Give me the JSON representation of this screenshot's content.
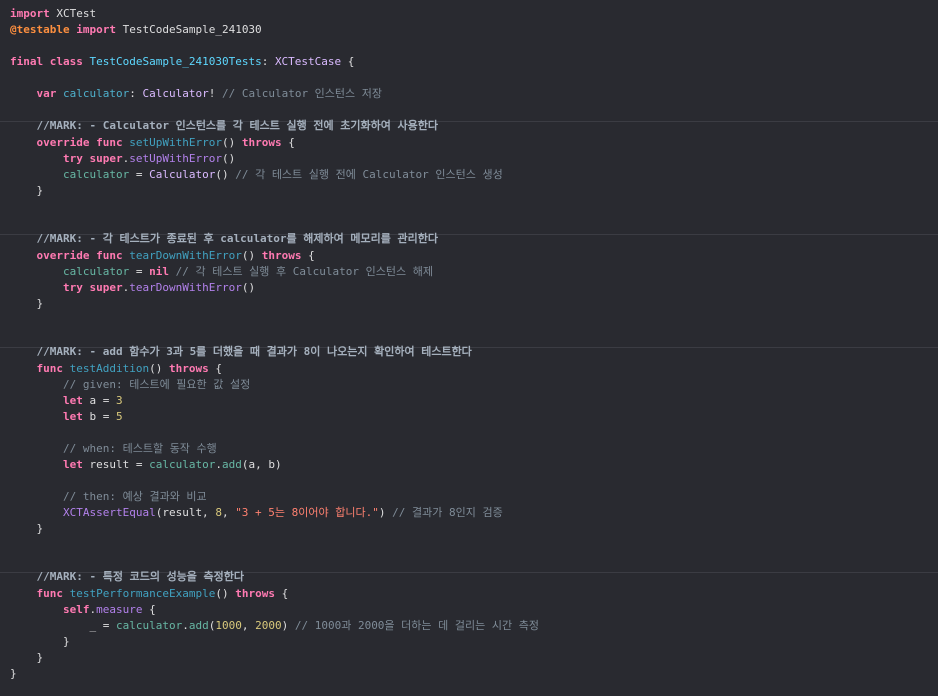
{
  "editor": {
    "lines": [
      {
        "spans": [
          {
            "c": "kw",
            "t": "import"
          },
          {
            "c": "plain",
            "t": " XCTest"
          }
        ]
      },
      {
        "spans": [
          {
            "c": "attr",
            "t": "@testable"
          },
          {
            "c": "plain",
            "t": " "
          },
          {
            "c": "kw",
            "t": "import"
          },
          {
            "c": "plain",
            "t": " TestCodeSample_241030"
          }
        ]
      },
      {
        "spans": []
      },
      {
        "spans": [
          {
            "c": "kw",
            "t": "final"
          },
          {
            "c": "plain",
            "t": " "
          },
          {
            "c": "kw",
            "t": "class"
          },
          {
            "c": "plain",
            "t": " "
          },
          {
            "c": "ctype",
            "t": "TestCodeSample_241030Tests"
          },
          {
            "c": "plain",
            "t": ": "
          },
          {
            "c": "type",
            "t": "XCTestCase"
          },
          {
            "c": "plain",
            "t": " {"
          }
        ]
      },
      {
        "spans": []
      },
      {
        "spans": [
          {
            "c": "ws",
            "t": "    "
          },
          {
            "c": "kw",
            "t": "var"
          },
          {
            "c": "plain",
            "t": " "
          },
          {
            "c": "prop",
            "t": "calculator"
          },
          {
            "c": "plain",
            "t": ": "
          },
          {
            "c": "type",
            "t": "Calculator"
          },
          {
            "c": "plain",
            "t": "! "
          },
          {
            "c": "cmt",
            "t": "// Calculator 인스턴스 저장"
          }
        ]
      },
      {
        "spans": []
      },
      {
        "spans": [
          {
            "c": "ws",
            "t": "    "
          },
          {
            "c": "mark",
            "t": "//MARK: - Calculator 인스턴스를 각 테스트 실행 전에 초기화하여 사용한다"
          }
        ]
      },
      {
        "spans": [
          {
            "c": "ws",
            "t": "    "
          },
          {
            "c": "kw",
            "t": "override"
          },
          {
            "c": "plain",
            "t": " "
          },
          {
            "c": "kw",
            "t": "func"
          },
          {
            "c": "plain",
            "t": " "
          },
          {
            "c": "fnd",
            "t": "setUpWithError"
          },
          {
            "c": "plain",
            "t": "() "
          },
          {
            "c": "kw",
            "t": "throws"
          },
          {
            "c": "plain",
            "t": " {"
          }
        ]
      },
      {
        "spans": [
          {
            "c": "ws",
            "t": "        "
          },
          {
            "c": "kw",
            "t": "try"
          },
          {
            "c": "plain",
            "t": " "
          },
          {
            "c": "kw",
            "t": "super"
          },
          {
            "c": "plain",
            "t": "."
          },
          {
            "c": "call",
            "t": "setUpWithError"
          },
          {
            "c": "plain",
            "t": "()"
          }
        ]
      },
      {
        "spans": [
          {
            "c": "ws",
            "t": "        "
          },
          {
            "c": "ucall",
            "t": "calculator"
          },
          {
            "c": "plain",
            "t": " = "
          },
          {
            "c": "type",
            "t": "Calculator"
          },
          {
            "c": "plain",
            "t": "() "
          },
          {
            "c": "cmt",
            "t": "// 각 테스트 실행 전에 Calculator 인스턴스 생성"
          }
        ]
      },
      {
        "spans": [
          {
            "c": "ws",
            "t": "    "
          },
          {
            "c": "plain",
            "t": "}"
          }
        ]
      },
      {
        "spans": []
      },
      {
        "spans": []
      },
      {
        "spans": [
          {
            "c": "ws",
            "t": "    "
          },
          {
            "c": "mark",
            "t": "//MARK: - 각 테스트가 종료된 후 calculator를 해제하여 메모리를 관리한다"
          }
        ]
      },
      {
        "spans": [
          {
            "c": "ws",
            "t": "    "
          },
          {
            "c": "kw",
            "t": "override"
          },
          {
            "c": "plain",
            "t": " "
          },
          {
            "c": "kw",
            "t": "func"
          },
          {
            "c": "plain",
            "t": " "
          },
          {
            "c": "fnd",
            "t": "tearDownWithError"
          },
          {
            "c": "plain",
            "t": "() "
          },
          {
            "c": "kw",
            "t": "throws"
          },
          {
            "c": "plain",
            "t": " {"
          }
        ]
      },
      {
        "spans": [
          {
            "c": "ws",
            "t": "        "
          },
          {
            "c": "ucall",
            "t": "calculator"
          },
          {
            "c": "plain",
            "t": " = "
          },
          {
            "c": "kw",
            "t": "nil"
          },
          {
            "c": "plain",
            "t": " "
          },
          {
            "c": "cmt",
            "t": "// 각 테스트 실행 후 Calculator 인스턴스 해제"
          }
        ]
      },
      {
        "spans": [
          {
            "c": "ws",
            "t": "        "
          },
          {
            "c": "kw",
            "t": "try"
          },
          {
            "c": "plain",
            "t": " "
          },
          {
            "c": "kw",
            "t": "super"
          },
          {
            "c": "plain",
            "t": "."
          },
          {
            "c": "call",
            "t": "tearDownWithError"
          },
          {
            "c": "plain",
            "t": "()"
          }
        ]
      },
      {
        "spans": [
          {
            "c": "ws",
            "t": "    "
          },
          {
            "c": "plain",
            "t": "}"
          }
        ]
      },
      {
        "spans": []
      },
      {
        "spans": []
      },
      {
        "spans": [
          {
            "c": "ws",
            "t": "    "
          },
          {
            "c": "mark",
            "t": "//MARK: - add 함수가 3과 5를 더했을 때 결과가 8이 나오는지 확인하여 테스트한다"
          }
        ]
      },
      {
        "spans": [
          {
            "c": "ws",
            "t": "    "
          },
          {
            "c": "kw",
            "t": "func"
          },
          {
            "c": "plain",
            "t": " "
          },
          {
            "c": "fnd",
            "t": "testAddition"
          },
          {
            "c": "plain",
            "t": "() "
          },
          {
            "c": "kw",
            "t": "throws"
          },
          {
            "c": "plain",
            "t": " {"
          }
        ]
      },
      {
        "spans": [
          {
            "c": "ws",
            "t": "        "
          },
          {
            "c": "cmt",
            "t": "// given: 테스트에 필요한 값 설정"
          }
        ]
      },
      {
        "spans": [
          {
            "c": "ws",
            "t": "        "
          },
          {
            "c": "kw",
            "t": "let"
          },
          {
            "c": "plain",
            "t": " a = "
          },
          {
            "c": "num",
            "t": "3"
          }
        ]
      },
      {
        "spans": [
          {
            "c": "ws",
            "t": "        "
          },
          {
            "c": "kw",
            "t": "let"
          },
          {
            "c": "plain",
            "t": " b = "
          },
          {
            "c": "num",
            "t": "5"
          }
        ]
      },
      {
        "spans": []
      },
      {
        "spans": [
          {
            "c": "ws",
            "t": "        "
          },
          {
            "c": "cmt",
            "t": "// when: 테스트할 동작 수행"
          }
        ]
      },
      {
        "spans": [
          {
            "c": "ws",
            "t": "        "
          },
          {
            "c": "kw",
            "t": "let"
          },
          {
            "c": "plain",
            "t": " result = "
          },
          {
            "c": "ucall",
            "t": "calculator"
          },
          {
            "c": "plain",
            "t": "."
          },
          {
            "c": "ucall",
            "t": "add"
          },
          {
            "c": "plain",
            "t": "(a, b)"
          }
        ]
      },
      {
        "spans": []
      },
      {
        "spans": [
          {
            "c": "ws",
            "t": "        "
          },
          {
            "c": "cmt",
            "t": "// then: 예상 결과와 비교"
          }
        ]
      },
      {
        "spans": [
          {
            "c": "ws",
            "t": "        "
          },
          {
            "c": "call",
            "t": "XCTAssertEqual"
          },
          {
            "c": "plain",
            "t": "(result, "
          },
          {
            "c": "num",
            "t": "8"
          },
          {
            "c": "plain",
            "t": ", "
          },
          {
            "c": "str",
            "t": "\"3 + 5는 8이어야 합니다.\""
          },
          {
            "c": "plain",
            "t": ") "
          },
          {
            "c": "cmt",
            "t": "// 결과가 8인지 검증"
          }
        ]
      },
      {
        "spans": [
          {
            "c": "ws",
            "t": "    "
          },
          {
            "c": "plain",
            "t": "}"
          }
        ]
      },
      {
        "spans": []
      },
      {
        "spans": []
      },
      {
        "spans": [
          {
            "c": "ws",
            "t": "    "
          },
          {
            "c": "mark",
            "t": "//MARK: - 특정 코드의 성능을 측정한다"
          }
        ]
      },
      {
        "spans": [
          {
            "c": "ws",
            "t": "    "
          },
          {
            "c": "kw",
            "t": "func"
          },
          {
            "c": "plain",
            "t": " "
          },
          {
            "c": "fnd",
            "t": "testPerformanceExample"
          },
          {
            "c": "plain",
            "t": "() "
          },
          {
            "c": "kw",
            "t": "throws"
          },
          {
            "c": "plain",
            "t": " {"
          }
        ]
      },
      {
        "spans": [
          {
            "c": "ws",
            "t": "        "
          },
          {
            "c": "kw",
            "t": "self"
          },
          {
            "c": "plain",
            "t": "."
          },
          {
            "c": "call",
            "t": "measure"
          },
          {
            "c": "plain",
            "t": " {"
          }
        ]
      },
      {
        "spans": [
          {
            "c": "ws",
            "t": "            "
          },
          {
            "c": "plain",
            "t": "_ = "
          },
          {
            "c": "ucall",
            "t": "calculator"
          },
          {
            "c": "plain",
            "t": "."
          },
          {
            "c": "ucall",
            "t": "add"
          },
          {
            "c": "plain",
            "t": "("
          },
          {
            "c": "num",
            "t": "1000"
          },
          {
            "c": "plain",
            "t": ", "
          },
          {
            "c": "num",
            "t": "2000"
          },
          {
            "c": "plain",
            "t": ") "
          },
          {
            "c": "cmt",
            "t": "// 1000과 2000을 더하는 데 걸리는 시간 측정"
          }
        ]
      },
      {
        "spans": [
          {
            "c": "ws",
            "t": "        "
          },
          {
            "c": "plain",
            "t": "}"
          }
        ]
      },
      {
        "spans": [
          {
            "c": "ws",
            "t": "    "
          },
          {
            "c": "plain",
            "t": "}"
          }
        ]
      },
      {
        "spans": [
          {
            "c": "plain",
            "t": "}"
          }
        ]
      }
    ]
  }
}
